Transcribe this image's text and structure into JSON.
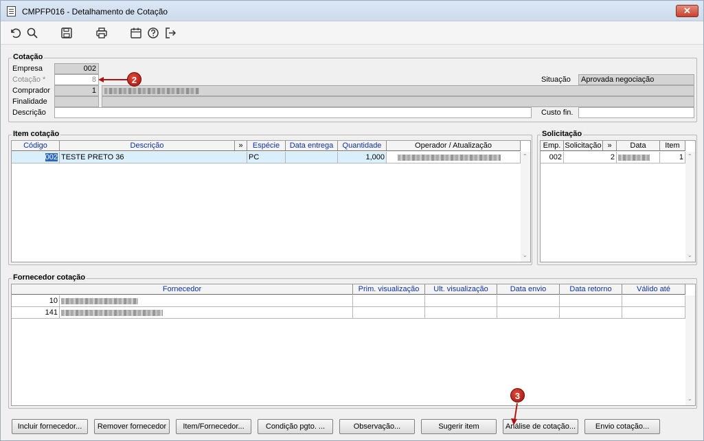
{
  "window": {
    "title": "CMPFP016 - Detalhamento de Cotação",
    "close_label": "✕"
  },
  "toolbar": {
    "icons": [
      "undo-icon",
      "search-icon",
      "save-icon",
      "print-icon",
      "calendar-icon",
      "help-icon",
      "exit-icon"
    ]
  },
  "cotacao": {
    "title": "Cotação",
    "empresa_label": "Empresa",
    "empresa_value": "002",
    "cotacao_label": "Cotação *",
    "cotacao_value": "8",
    "comprador_label": "Comprador",
    "comprador_value": "1",
    "finalidade_label": "Finalidade",
    "descricao_label": "Descrição",
    "descricao_value": "",
    "situacao_label": "Situação",
    "situacao_value": "Aprovada negociação",
    "custo_label": "Custo fin.",
    "custo_value": ""
  },
  "item_cotacao": {
    "title": "Item cotação",
    "columns": [
      "Código",
      "Descrição",
      "»",
      "Espécie",
      "Data entrega",
      "Quantidade",
      "Operador / Atualização"
    ],
    "rows": [
      {
        "codigo": "002",
        "descricao": "TESTE PRETO 36",
        "especie": "PC",
        "data_entrega": "",
        "quantidade": "1,000"
      }
    ]
  },
  "solicitacao": {
    "title": "Solicitação",
    "columns": [
      "Emp.",
      "Solicitação",
      "»",
      "Data",
      "Item"
    ],
    "rows": [
      {
        "emp": "002",
        "solicitacao": "2",
        "item": "1"
      }
    ]
  },
  "fornecedor": {
    "title": "Fornecedor cotação",
    "columns": [
      "Fornecedor",
      "Prim. visualização",
      "Ult. visualização",
      "Data envio",
      "Data retorno",
      "Válido até"
    ],
    "rows": [
      {
        "codigo": "10"
      },
      {
        "codigo": "141"
      }
    ]
  },
  "buttons": [
    "Incluir fornecedor...",
    "Remover fornecedor",
    "Item/Fornecedor...",
    "Condição pgto. ...",
    "Observação...",
    "Sugerir item",
    "Análise de cotação...",
    "Envio cotação..."
  ],
  "markers": [
    "2",
    "3"
  ],
  "colors": {
    "accent": "#2b68c6",
    "header_text": "#0c2fa0",
    "selected_row": "#d9effb",
    "marker": "#c11a12"
  }
}
